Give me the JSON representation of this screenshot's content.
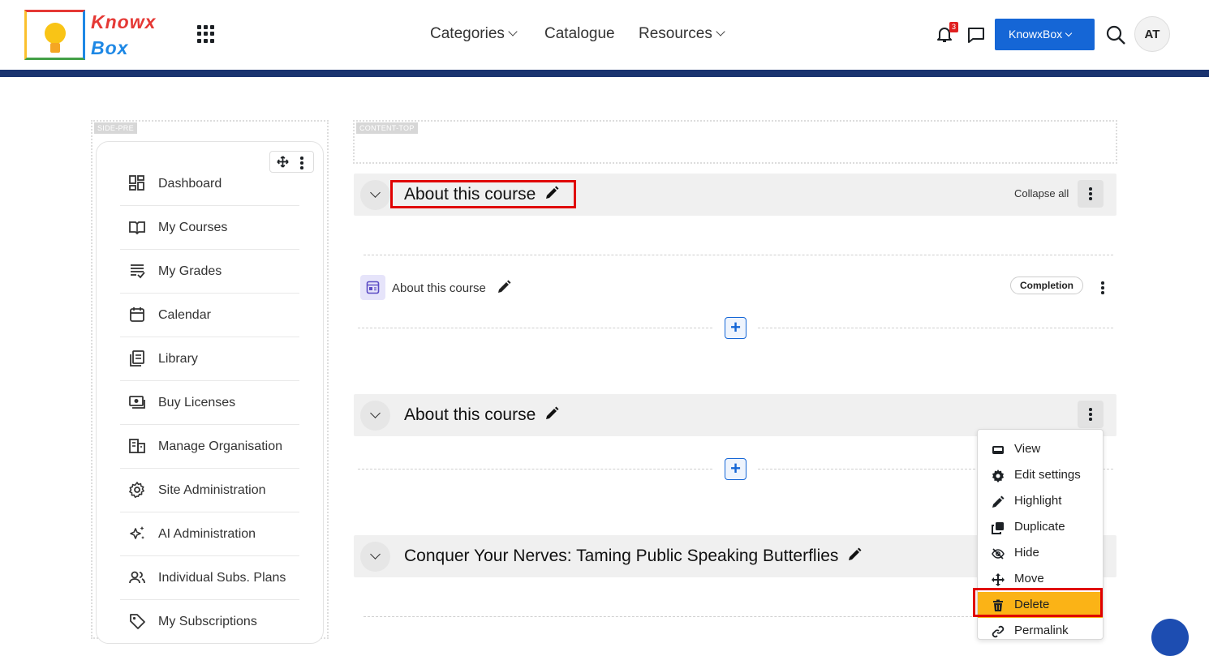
{
  "header": {
    "logo_line1": "Knowx",
    "logo_line2": "Box",
    "nav": [
      {
        "label": "Categories",
        "has_dropdown": true
      },
      {
        "label": "Catalogue",
        "has_dropdown": false
      },
      {
        "label": "Resources",
        "has_dropdown": true
      }
    ],
    "notification_count": "3",
    "org_button": "KnowxBox",
    "avatar_initials": "AT",
    "icons": [
      "app-grid-icon",
      "bell-icon",
      "message-icon",
      "search-icon"
    ]
  },
  "regions": {
    "side_pre": "SIDE-PRE",
    "content_top": "CONTENT-TOP"
  },
  "sidebar": {
    "items": [
      {
        "label": "Dashboard",
        "icon": "dashboard-icon"
      },
      {
        "label": "My Courses",
        "icon": "courses-icon"
      },
      {
        "label": "My Grades",
        "icon": "grades-icon"
      },
      {
        "label": "Calendar",
        "icon": "calendar-icon"
      },
      {
        "label": "Library",
        "icon": "library-icon"
      },
      {
        "label": "Buy Licenses",
        "icon": "licenses-icon"
      },
      {
        "label": "Manage Organisation",
        "icon": "organisation-icon"
      },
      {
        "label": "Site Administration",
        "icon": "gear-icon"
      },
      {
        "label": "AI Administration",
        "icon": "sparkle-icon"
      },
      {
        "label": "Individual Subs. Plans",
        "icon": "users-icon"
      },
      {
        "label": "My Subscriptions",
        "icon": "tag-icon"
      }
    ]
  },
  "course": {
    "collapse_all": "Collapse all",
    "sections": [
      {
        "title": "About this course"
      },
      {
        "title": "About this course"
      },
      {
        "title": "Conquer Your Nerves: Taming Public Speaking Butterflies"
      }
    ],
    "activity": {
      "name": "About this course",
      "completion_label": "Completion"
    }
  },
  "section_menu": {
    "items": [
      {
        "label": "View",
        "icon": "view-icon"
      },
      {
        "label": "Edit settings",
        "icon": "gear-icon"
      },
      {
        "label": "Highlight",
        "icon": "highlight-icon"
      },
      {
        "label": "Duplicate",
        "icon": "duplicate-icon"
      },
      {
        "label": "Hide",
        "icon": "eye-slash-icon"
      },
      {
        "label": "Move",
        "icon": "move-icon"
      },
      {
        "label": "Delete",
        "icon": "trash-icon"
      },
      {
        "label": "Permalink",
        "icon": "link-icon"
      }
    ],
    "active_item": "Delete",
    "active_color": "#fbb316"
  },
  "colors": {
    "brand_blue": "#1566d6",
    "header_bar": "#1b3470",
    "annotation_red": "#e00000"
  }
}
